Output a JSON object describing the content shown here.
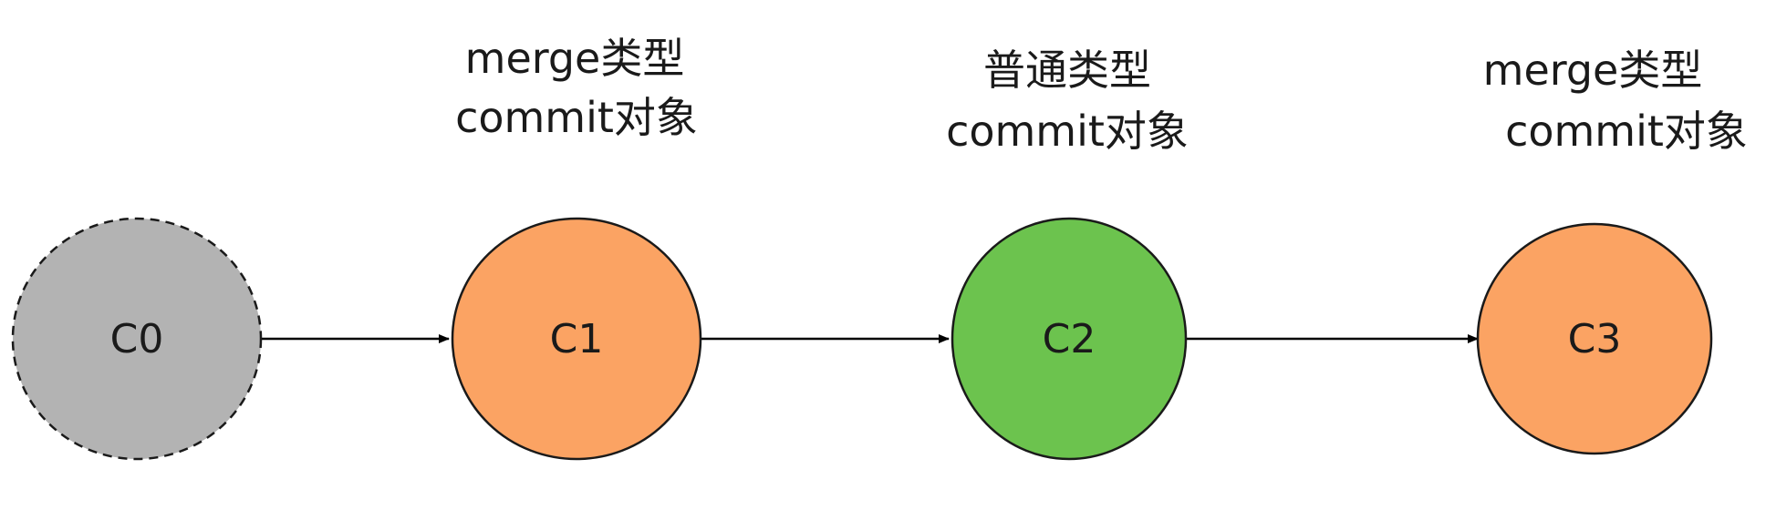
{
  "colors": {
    "inactive": "#b3b3b3",
    "merge": "#fba363",
    "normal": "#6cc34e",
    "stroke": "#1a1a1a",
    "edge": "#000000"
  },
  "nodes": [
    {
      "id": "c0",
      "label": "C0",
      "kind": "inactive",
      "caption": []
    },
    {
      "id": "c1",
      "label": "C1",
      "kind": "merge",
      "caption": [
        "merge类型",
        "commit对象"
      ]
    },
    {
      "id": "c2",
      "label": "C2",
      "kind": "normal",
      "caption": [
        "普通类型",
        "commit对象"
      ]
    },
    {
      "id": "c3",
      "label": "C3",
      "kind": "merge",
      "caption": [
        "merge类型",
        "commit对象"
      ]
    }
  ],
  "edges": [
    {
      "from": "c0",
      "to": "c1"
    },
    {
      "from": "c1",
      "to": "c2"
    },
    {
      "from": "c2",
      "to": "c3"
    }
  ]
}
